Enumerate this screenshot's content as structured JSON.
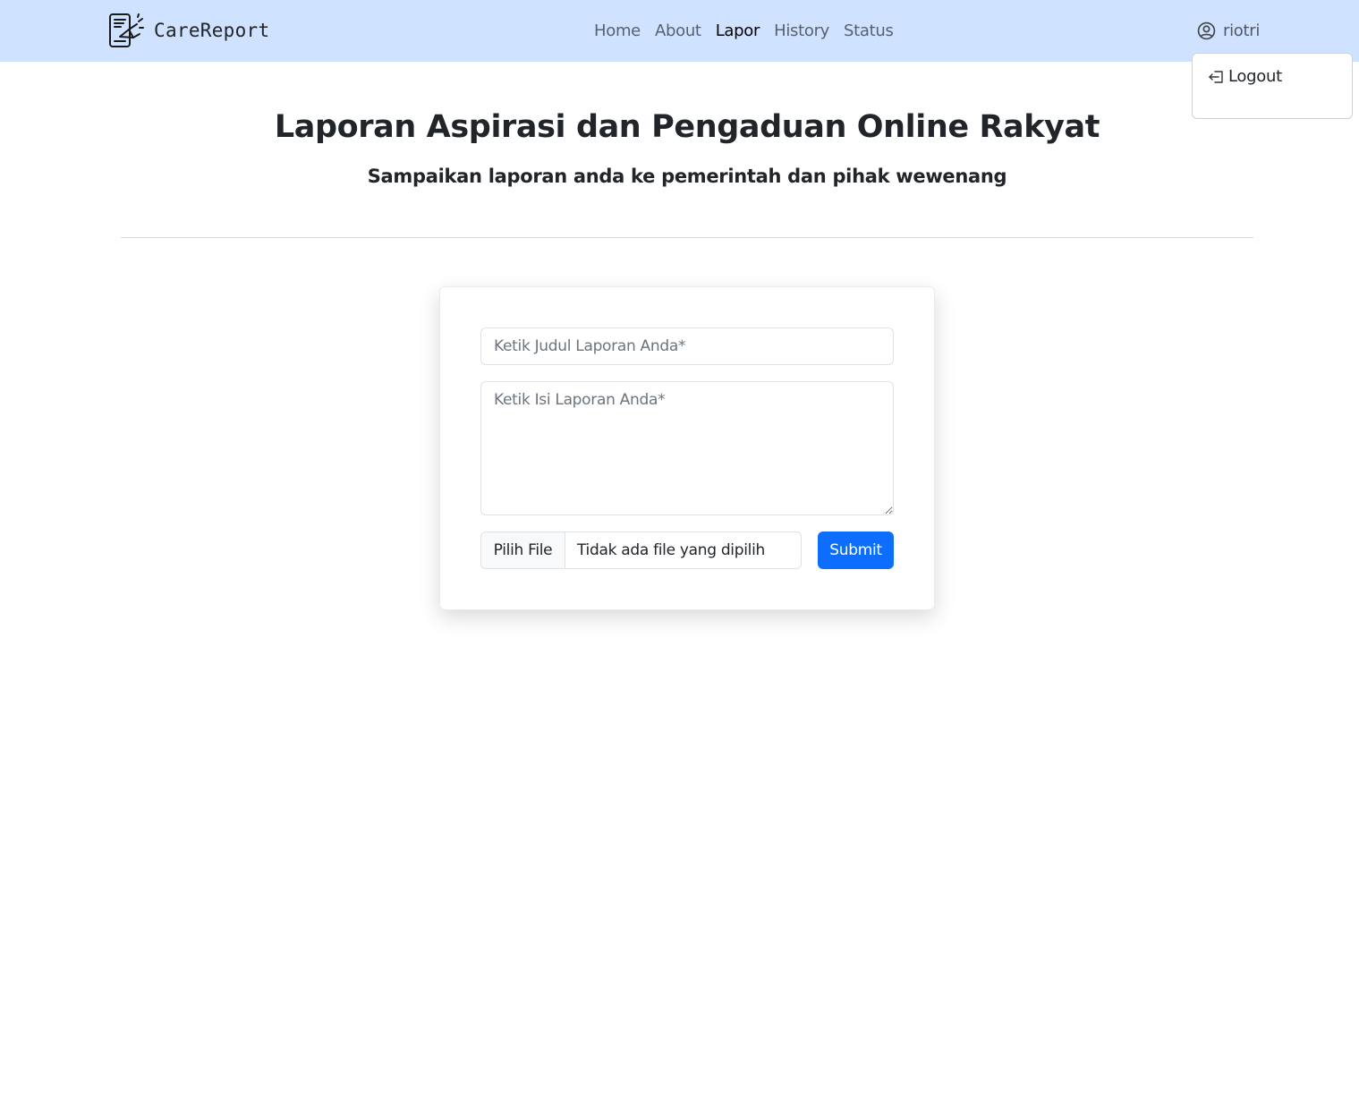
{
  "brand": {
    "name": "CareReport",
    "logo_icon": "report-megaphone-icon"
  },
  "nav": {
    "items": [
      {
        "label": "Home",
        "active": false
      },
      {
        "label": "About",
        "active": false
      },
      {
        "label": "Lapor",
        "active": true
      },
      {
        "label": "History",
        "active": false
      },
      {
        "label": "Status",
        "active": false
      }
    ],
    "background": "#cfe2ff"
  },
  "user": {
    "name": "riotri",
    "icon": "user-circle-icon"
  },
  "dropdown": {
    "logout_label": "Logout",
    "logout_icon": "logout-icon"
  },
  "hero": {
    "title": "Laporan Aspirasi dan Pengaduan Online Rakyat",
    "subtitle": "Sampaikan laporan anda ke pemerintah dan pihak wewenang"
  },
  "form": {
    "title_placeholder": "Ketik Judul Laporan Anda*",
    "body_placeholder": "Ketik Isi Laporan Anda*",
    "file_button": "Pilih File",
    "file_status": "Tidak ada file yang dipilih",
    "submit_label": "Submit",
    "submit_color": "#0d6efd"
  }
}
